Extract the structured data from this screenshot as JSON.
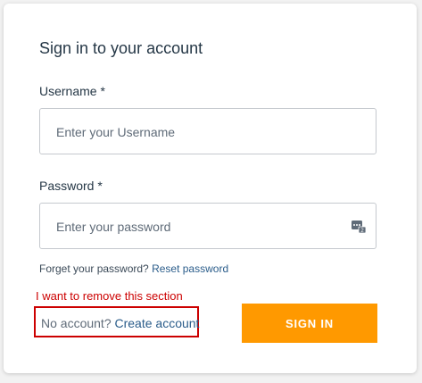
{
  "form": {
    "title": "Sign in to your account",
    "username": {
      "label": "Username *",
      "placeholder": "Enter your Username",
      "value": ""
    },
    "password": {
      "label": "Password *",
      "placeholder": "Enter your password",
      "value": "",
      "icon": "password-manager-icon"
    },
    "forgot": {
      "prefix": "Forget your password?",
      "link": "Reset password"
    },
    "annotation": "I want to remove this section",
    "signup": {
      "prefix": "No account?",
      "link": "Create account"
    },
    "submit_label": "SIGN IN"
  },
  "colors": {
    "accent": "#ff9900",
    "link": "#2a5c8a",
    "annotation": "#cc0000",
    "text": "#253746"
  }
}
